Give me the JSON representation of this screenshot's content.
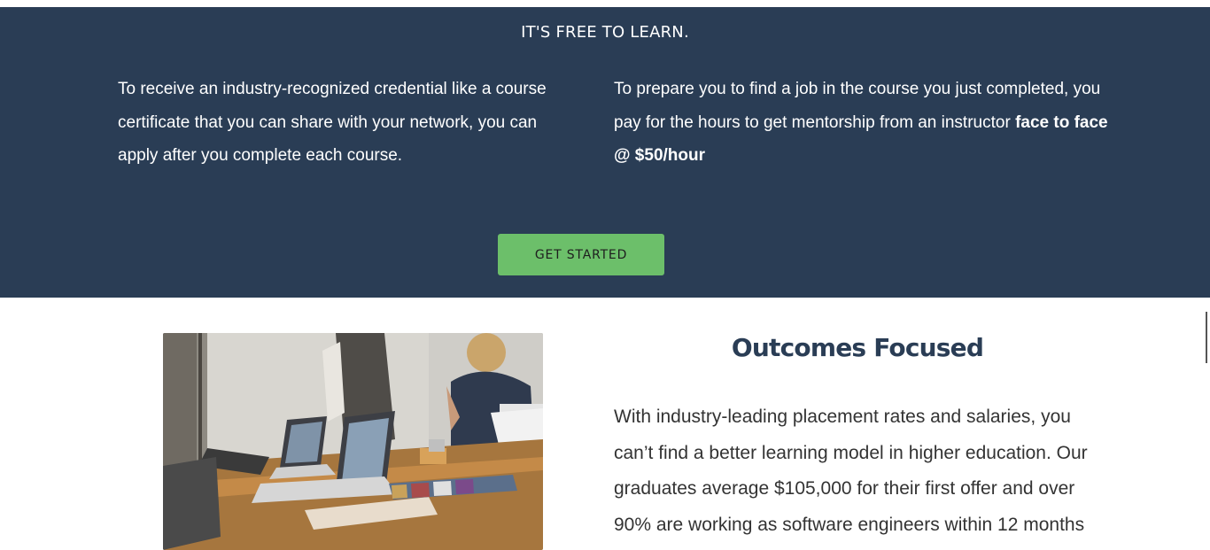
{
  "hero": {
    "title": "IT'S FREE TO LEARN.",
    "left_text": "To receive an industry-recognized credential like a course certificate that you can share with your network, you can apply after you complete each course.",
    "right_text_prefix": "To prepare you to find a job in the course you just completed, you pay for the hours to get mentorship from an instructor ",
    "right_text_bold": "face to face @ $50/hour",
    "cta_label": "GET STARTED",
    "background_color": "#2a3d55",
    "cta_color": "#6cbf6a"
  },
  "outcomes": {
    "title": "Outcomes Focused",
    "body": "With industry-leading placement rates and salaries, you can’t find a better learning model in higher education. Our graduates average $105,000 for their first offer and over 90% are working as software engineers within 12 months",
    "image_icon": "team-meeting-photo"
  }
}
